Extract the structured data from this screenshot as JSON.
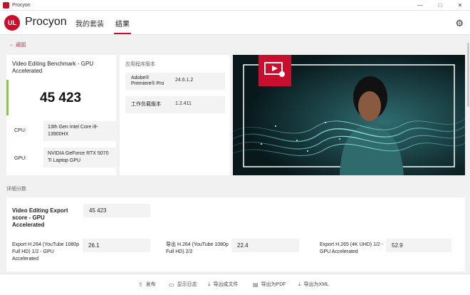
{
  "window": {
    "title": "Procyon",
    "minimize": "—",
    "maximize": "□",
    "close": "✕"
  },
  "nav": {
    "logo": "UL",
    "brand": "Procyon",
    "tabs": [
      {
        "label": "我的套装"
      },
      {
        "label": "结果"
      }
    ]
  },
  "back_label": "← 返回",
  "score": {
    "label": "Video Editing Benchmark - GPU Accelerated",
    "value": "45 423",
    "cpu_key": "CPU:",
    "cpu_val": "13th Gen Intel Core i9-13900HX",
    "gpu_key": "GPU:",
    "gpu_val": "NVIDIA GeForce RTX 5070 Ti Laptop GPU"
  },
  "versions": {
    "title": "应用程序版本",
    "rows": [
      {
        "key": "Adobe® Premiere® Pro",
        "val": "24.6.1.2"
      },
      {
        "key": "工作负载版本",
        "val": "1.2.411"
      }
    ]
  },
  "details": {
    "section_title": "详细分数",
    "main_label": "Video Editing Export score - GPU Accelerated",
    "main_value": "45 423",
    "items": [
      {
        "label": "Export H.264 (YouTube 1080p Full HD) 1/2 - GPU Accelerated",
        "value": "26.1"
      },
      {
        "label": "导出 H.264 (YouTube 1080p Full HD) 2/2",
        "value": "22.4"
      },
      {
        "label": "Export H.265 (4K UHD) 1/2 - GPU Accelerated",
        "value": "52.9"
      }
    ]
  },
  "footer": {
    "items": [
      {
        "label": "发布"
      },
      {
        "label": "显示日志"
      },
      {
        "label": "导出成文件"
      },
      {
        "label": "导出为PDF"
      },
      {
        "label": "导出为XML"
      }
    ]
  },
  "colors": {
    "accent": "#c8102e",
    "score_bar": "#8bc34a"
  }
}
